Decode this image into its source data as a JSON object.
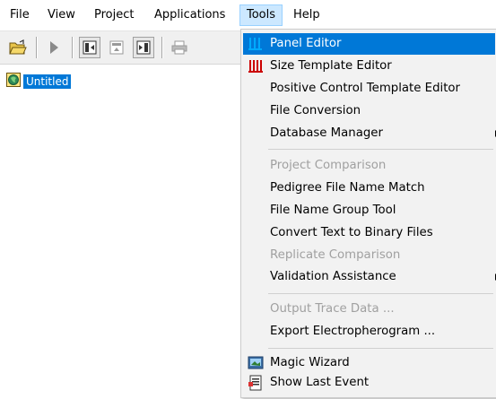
{
  "menubar": {
    "items": [
      {
        "label": "File"
      },
      {
        "label": "View"
      },
      {
        "label": "Project"
      },
      {
        "label": "Applications"
      },
      {
        "label": "Tools"
      },
      {
        "label": "Help"
      }
    ],
    "open_menu": "Tools"
  },
  "toolbar": {
    "icons": [
      "open-folder-icon",
      "play-icon",
      "panel-left-icon",
      "panel-top-icon",
      "panel-right-icon",
      "print-icon"
    ]
  },
  "tree": {
    "root_label": "Untitled",
    "root_icon": "project-globe-icon"
  },
  "tools_menu": {
    "items": [
      {
        "label": "Panel Editor",
        "icon": "panel-editor-icon",
        "highlighted": true
      },
      {
        "label": "Size Template Editor",
        "icon": "size-template-icon"
      },
      {
        "label": "Positive Control Template Editor"
      },
      {
        "label": "File Conversion"
      },
      {
        "label": "Database Manager",
        "submenu": true
      },
      {
        "label": "Project Comparison",
        "disabled": true
      },
      {
        "label": "Pedigree File Name Match"
      },
      {
        "label": "File Name Group Tool"
      },
      {
        "label": "Convert Text to Binary Files"
      },
      {
        "label": "Replicate Comparison",
        "disabled": true
      },
      {
        "label": "Validation Assistance",
        "submenu": true
      },
      {
        "label": "Output Trace Data ...",
        "disabled": true
      },
      {
        "label": "Export Electropherogram ..."
      },
      {
        "label": "Magic Wizard",
        "icon": "magic-wizard-icon"
      },
      {
        "label": "Show Last Event",
        "icon": "show-last-event-icon"
      }
    ]
  },
  "colors": {
    "highlight": "#0078d7",
    "menu_bg": "#f2f2f2",
    "disabled_text": "#a0a0a0"
  }
}
